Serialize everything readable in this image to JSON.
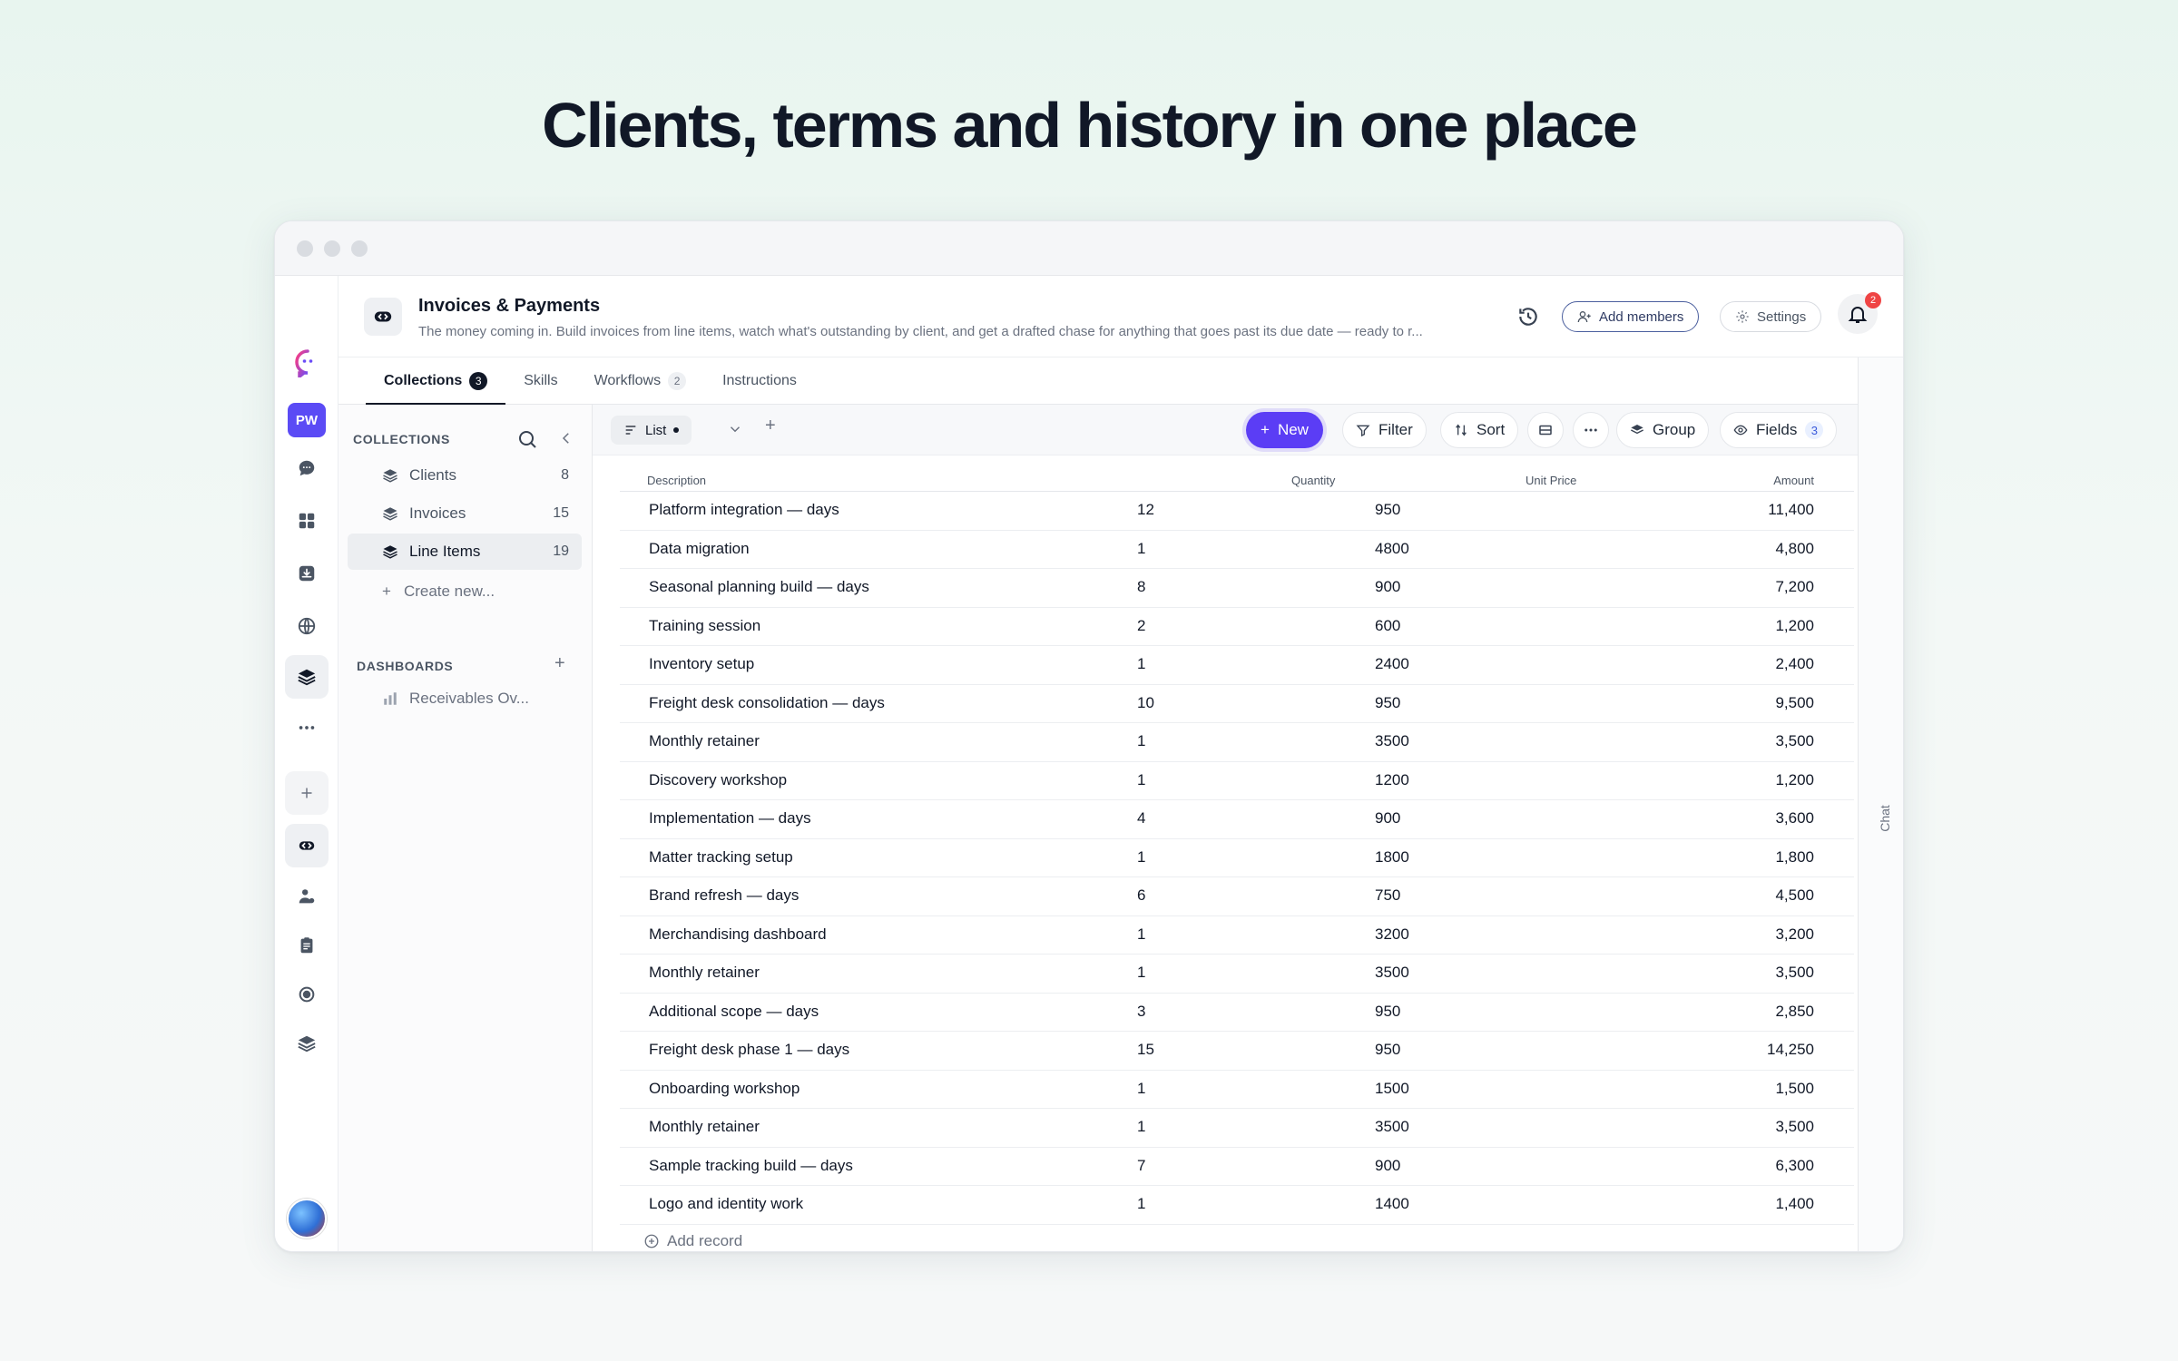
{
  "headline": "Clients, terms and history in one place",
  "rail": {
    "user_initials": "PW"
  },
  "header": {
    "title": "Invoices & Payments",
    "description": "The money coming in. Build invoices from line items, watch what's outstanding by client, and get a drafted chase for anything that goes past its due date — ready to r...",
    "add_members": "Add members",
    "settings": "Settings",
    "notifications_count": "2"
  },
  "tabs": [
    {
      "label": "Collections",
      "count": "3"
    },
    {
      "label": "Skills",
      "count": ""
    },
    {
      "label": "Workflows",
      "count": "2"
    },
    {
      "label": "Instructions",
      "count": ""
    }
  ],
  "chat_label": "Chat",
  "sidebar": {
    "collections_heading": "COLLECTIONS",
    "items": [
      {
        "label": "Clients",
        "count": "8"
      },
      {
        "label": "Invoices",
        "count": "15"
      },
      {
        "label": "Line Items",
        "count": "19"
      }
    ],
    "create_new": "Create new...",
    "dashboards_heading": "DASHBOARDS",
    "dashboard_item": "Receivables Ov..."
  },
  "toolbar": {
    "view_label": "List",
    "new_label": "New",
    "filter_label": "Filter",
    "sort_label": "Sort",
    "group_label": "Group",
    "fields_label": "Fields",
    "fields_count": "3"
  },
  "table": {
    "columns": [
      "Description",
      "Quantity",
      "Unit Price",
      "Amount"
    ],
    "rows": [
      [
        "Platform integration — days",
        "12",
        "950",
        "11,400"
      ],
      [
        "Data migration",
        "1",
        "4800",
        "4,800"
      ],
      [
        "Seasonal planning build — days",
        "8",
        "900",
        "7,200"
      ],
      [
        "Training session",
        "2",
        "600",
        "1,200"
      ],
      [
        "Inventory setup",
        "1",
        "2400",
        "2,400"
      ],
      [
        "Freight desk consolidation — days",
        "10",
        "950",
        "9,500"
      ],
      [
        "Monthly retainer",
        "1",
        "3500",
        "3,500"
      ],
      [
        "Discovery workshop",
        "1",
        "1200",
        "1,200"
      ],
      [
        "Implementation — days",
        "4",
        "900",
        "3,600"
      ],
      [
        "Matter tracking setup",
        "1",
        "1800",
        "1,800"
      ],
      [
        "Brand refresh — days",
        "6",
        "750",
        "4,500"
      ],
      [
        "Merchandising dashboard",
        "1",
        "3200",
        "3,200"
      ],
      [
        "Monthly retainer",
        "1",
        "3500",
        "3,500"
      ],
      [
        "Additional scope — days",
        "3",
        "950",
        "2,850"
      ],
      [
        "Freight desk phase 1 — days",
        "15",
        "950",
        "14,250"
      ],
      [
        "Onboarding workshop",
        "1",
        "1500",
        "1,500"
      ],
      [
        "Monthly retainer",
        "1",
        "3500",
        "3,500"
      ],
      [
        "Sample tracking build — days",
        "7",
        "900",
        "6,300"
      ],
      [
        "Logo and identity work",
        "1",
        "1400",
        "1,400"
      ]
    ],
    "add_record": "Add record"
  }
}
